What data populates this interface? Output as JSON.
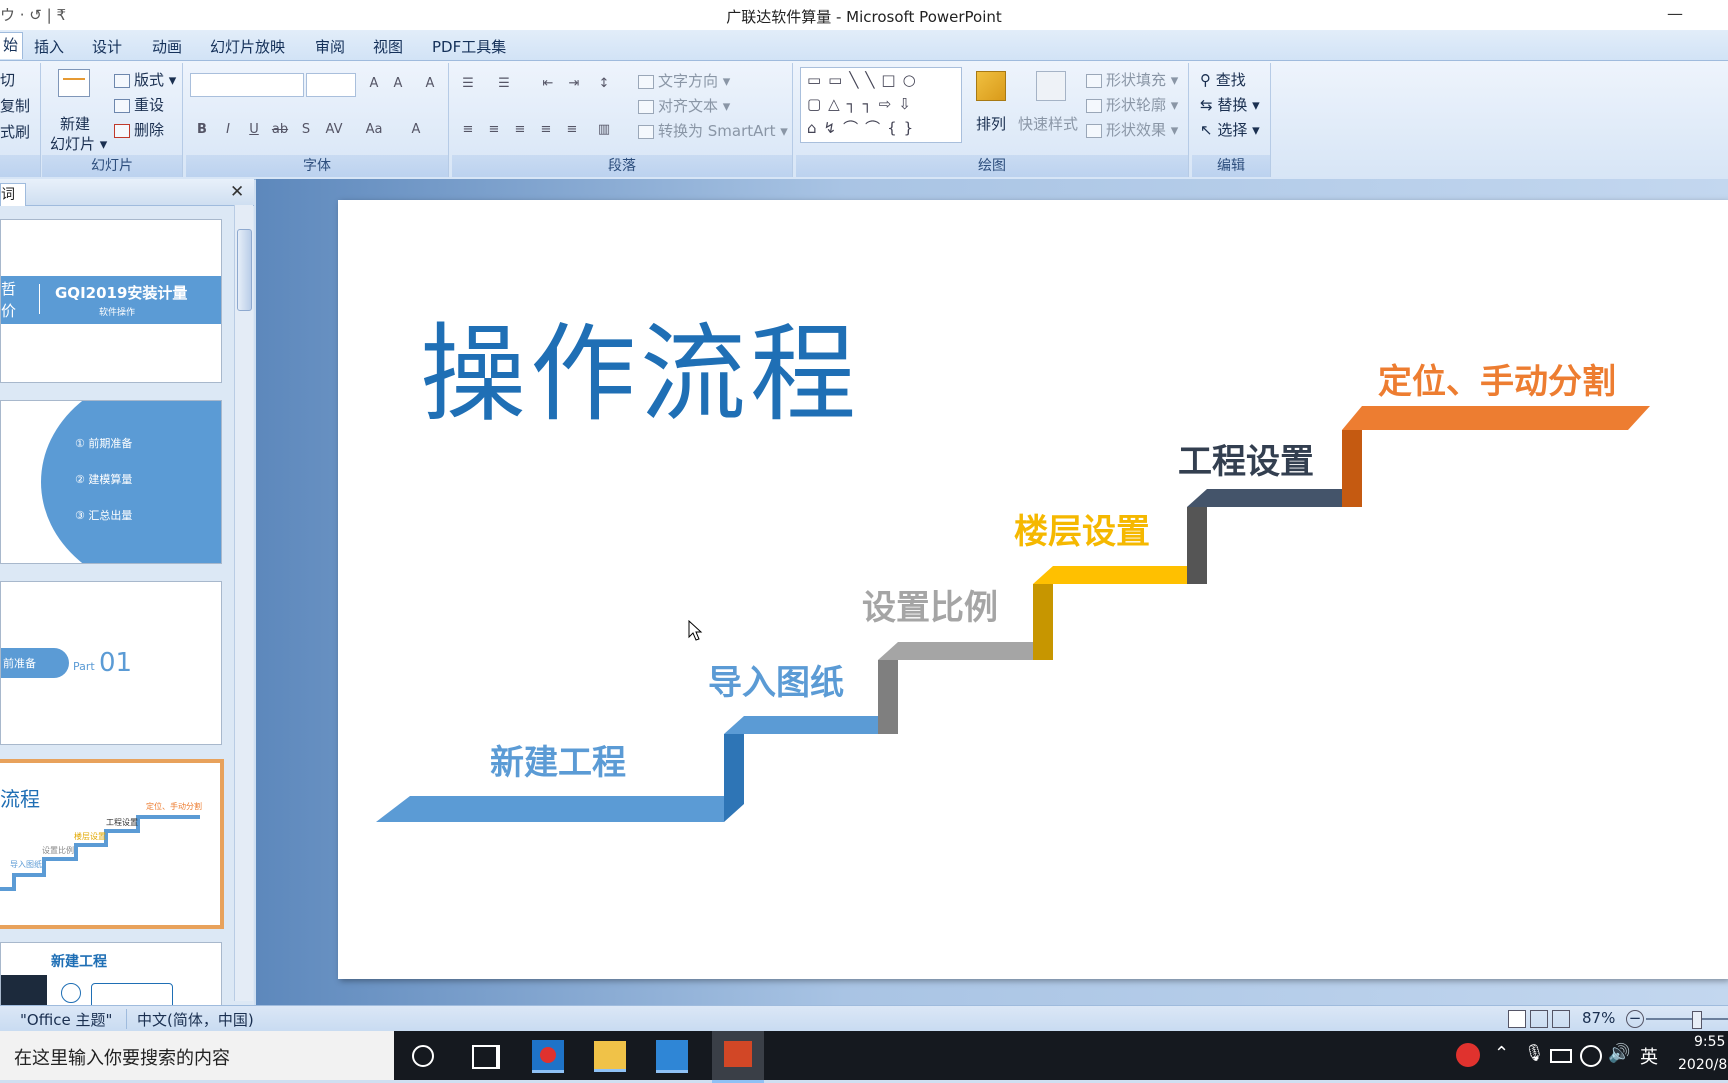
{
  "window": {
    "title": "广联达软件算量 - Microsoft PowerPoint",
    "qat": "ウ · ↺ | ₹",
    "minimize": "—"
  },
  "tabs": [
    "始",
    "插入",
    "设计",
    "动画",
    "幻灯片放映",
    "审阅",
    "视图",
    "PDF工具集"
  ],
  "ribbon": {
    "clipboard": {
      "cut": "切",
      "copy": "复制",
      "painter": "式刷"
    },
    "slides": {
      "label": "幻灯片",
      "new_slide_1": "新建",
      "new_slide_2": "幻灯片 ▾",
      "layout": "版式 ▾",
      "reset": "重设",
      "delete": "删除"
    },
    "font": {
      "label": "字体"
    },
    "paragraph": {
      "label": "段落",
      "text_direction": "文字方向 ▾",
      "align_text": "对齐文本 ▾",
      "smartart": "转换为 SmartArt ▾"
    },
    "drawing": {
      "label": "绘图",
      "arrange": "排列",
      "quick_styles": "快速样式",
      "shape_fill": "形状填充 ▾",
      "shape_outline": "形状轮廓 ▾",
      "shape_effects": "形状效果 ▾"
    },
    "editing": {
      "label": "编辑",
      "find": "查找",
      "replace": "替换 ▾",
      "select": "选择 ▾"
    }
  },
  "pane": {
    "tab_label": "词",
    "close": "✕",
    "thumb1": {
      "left_1": "哲",
      "left_2": "价",
      "title": "GQI2019安装计量",
      "subtitle": "软件操作"
    },
    "thumb2": {
      "items": [
        "① 前期准备",
        "② 建模算量",
        "③ 汇总出量"
      ]
    },
    "thumb3": {
      "pill": "前准备",
      "part": "Part",
      "num": "01"
    },
    "thumb4": {
      "title": "流程",
      "steps": [
        "导入图纸",
        "设置比例",
        "楼层设置",
        "工程设置",
        "定位、手动分割"
      ]
    },
    "thumb5": {
      "title": "新建工程"
    }
  },
  "slide": {
    "title": "操作流程",
    "steps": [
      {
        "label": "新建工程",
        "color": "#5b9bd5"
      },
      {
        "label": "导入图纸",
        "color": "#5b9bd5"
      },
      {
        "label": "设置比例",
        "color": "#a5a5a5"
      },
      {
        "label": "楼层设置",
        "color": "#ffc000"
      },
      {
        "label": "工程设置",
        "color": "#44546a"
      },
      {
        "label": "定位、手动分割",
        "color": "#ed7d31"
      }
    ],
    "title_color": "#1f6fb5"
  },
  "status": {
    "theme": "\"Office 主题\"",
    "language": "中文(简体，中国)",
    "zoom": "87%"
  },
  "taskbar": {
    "search_placeholder": "在这里输入你要搜索的内容",
    "time": "9:55",
    "date": "2020/8",
    "ime": "英"
  }
}
